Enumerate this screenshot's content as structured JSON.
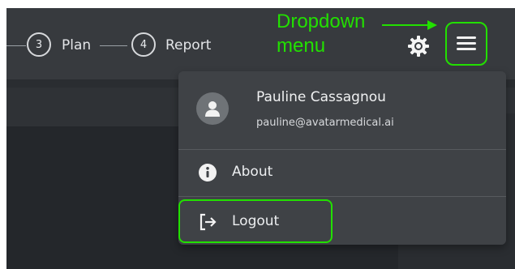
{
  "stepper": {
    "steps": [
      {
        "number": "3",
        "label": "Plan"
      },
      {
        "number": "4",
        "label": "Report"
      }
    ]
  },
  "header": {
    "settings_icon": "gear-icon",
    "menu_icon": "hamburger-menu-icon"
  },
  "annotation": {
    "line1": "Dropdown",
    "line2": "menu",
    "color": "#22e000"
  },
  "dropdown": {
    "user": {
      "name": "Pauline Cassagnou",
      "email": "pauline@avatarmedical.ai"
    },
    "items": [
      {
        "label": "About",
        "icon": "info-icon"
      },
      {
        "label": "Logout",
        "icon": "logout-icon"
      }
    ]
  },
  "colors": {
    "highlight": "#22e000",
    "menu_background": "#3f4246",
    "topbar_background": "#373a3e"
  }
}
